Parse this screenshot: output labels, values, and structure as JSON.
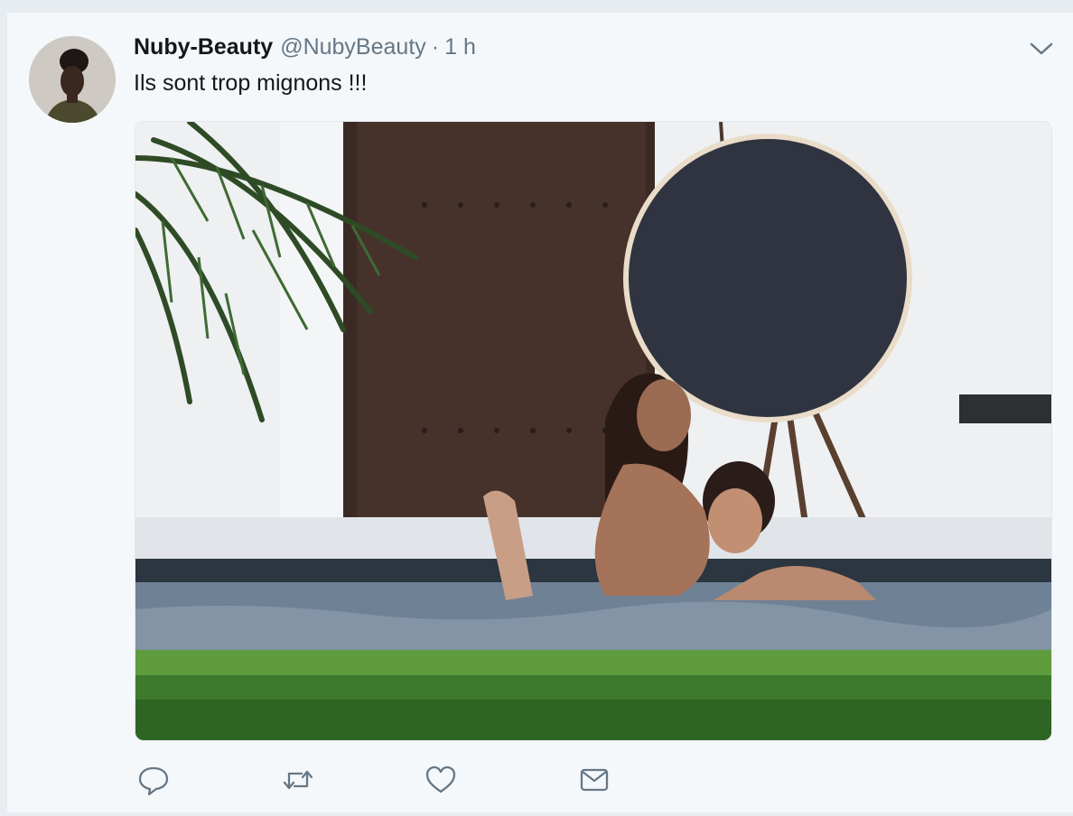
{
  "tweet": {
    "author": {
      "fullname": "Nuby-Beauty",
      "username": "@NubyBeauty",
      "avatar_icon": "avatar-photo"
    },
    "separator": "·",
    "time": "1 h",
    "text": "Ils sont trop mignons !!!",
    "media": {
      "kind": "photo",
      "icon": "photo-pool-scene"
    },
    "actions": [
      {
        "name": "reply",
        "icon": "reply-icon"
      },
      {
        "name": "retweet",
        "icon": "retweet-icon"
      },
      {
        "name": "like",
        "icon": "heart-icon"
      },
      {
        "name": "direct-message",
        "icon": "envelope-icon"
      }
    ],
    "menu_icon": "chevron-down-icon"
  },
  "colors": {
    "background": "#f5f8fa",
    "name": "#14171a",
    "secondary": "#657786"
  }
}
